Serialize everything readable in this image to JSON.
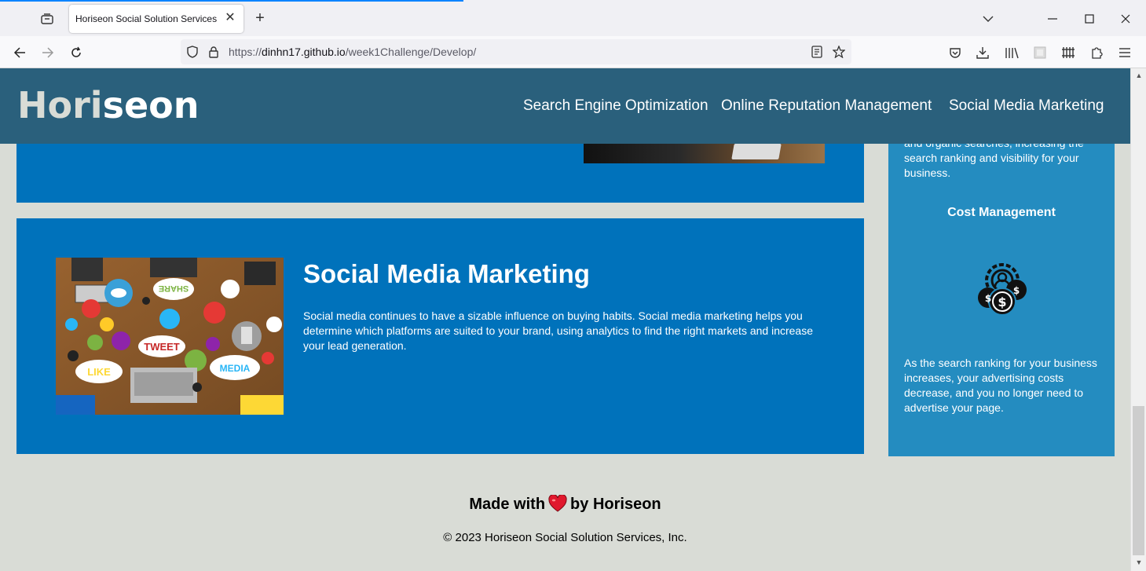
{
  "browser": {
    "tab_title": "Horiseon Social Solution Services",
    "url_host": "dinhn17.github.io",
    "url_scheme": "https://",
    "url_path": "/week1Challenge/Develop/"
  },
  "header": {
    "logo_main": "Hori",
    "logo_accent": "seon",
    "nav": [
      "Search Engine Optimization",
      "Online Reputation Management",
      "Social Media Marketing"
    ]
  },
  "main": {
    "smm_title": "Social Media Marketing",
    "smm_text": "Social media continues to have a sizable influence on buying habits. Social media marketing helps you determine which platforms are suited to your brand, using analytics to find the right markets and increase your lead generation.",
    "smm_image_words": [
      "SHARE",
      "TWEET",
      "LIKE",
      "MEDIA"
    ]
  },
  "aside": {
    "text_top": "and organic searches, increasing the search ranking and visibility for your business.",
    "cost_heading": "Cost Management",
    "cost_text": "As the search ranking for your business increases, your advertising costs decrease, and you no longer need to advertise your page."
  },
  "footer": {
    "made_before": "Made with",
    "made_after": "by Horiseon",
    "copyright": "© 2023 Horiseon Social Solution Services, Inc."
  },
  "colors": {
    "header_bg": "#2a607c",
    "card_bg": "#0072bb",
    "aside_bg": "#248cc0",
    "page_bg": "#d9dcd6",
    "heart": "#e0182d"
  },
  "icons": [
    "tab-list-icon",
    "close-icon",
    "plus-icon",
    "chevron-down-icon",
    "minimize-icon",
    "maximize-icon",
    "back-icon",
    "forward-icon",
    "reload-icon",
    "shield-icon",
    "lock-icon",
    "reader-view-icon",
    "star-icon",
    "pocket-icon",
    "download-icon",
    "library-icon",
    "extension-icon",
    "menu-icon",
    "heart-icon",
    "cost-gears-icon"
  ]
}
